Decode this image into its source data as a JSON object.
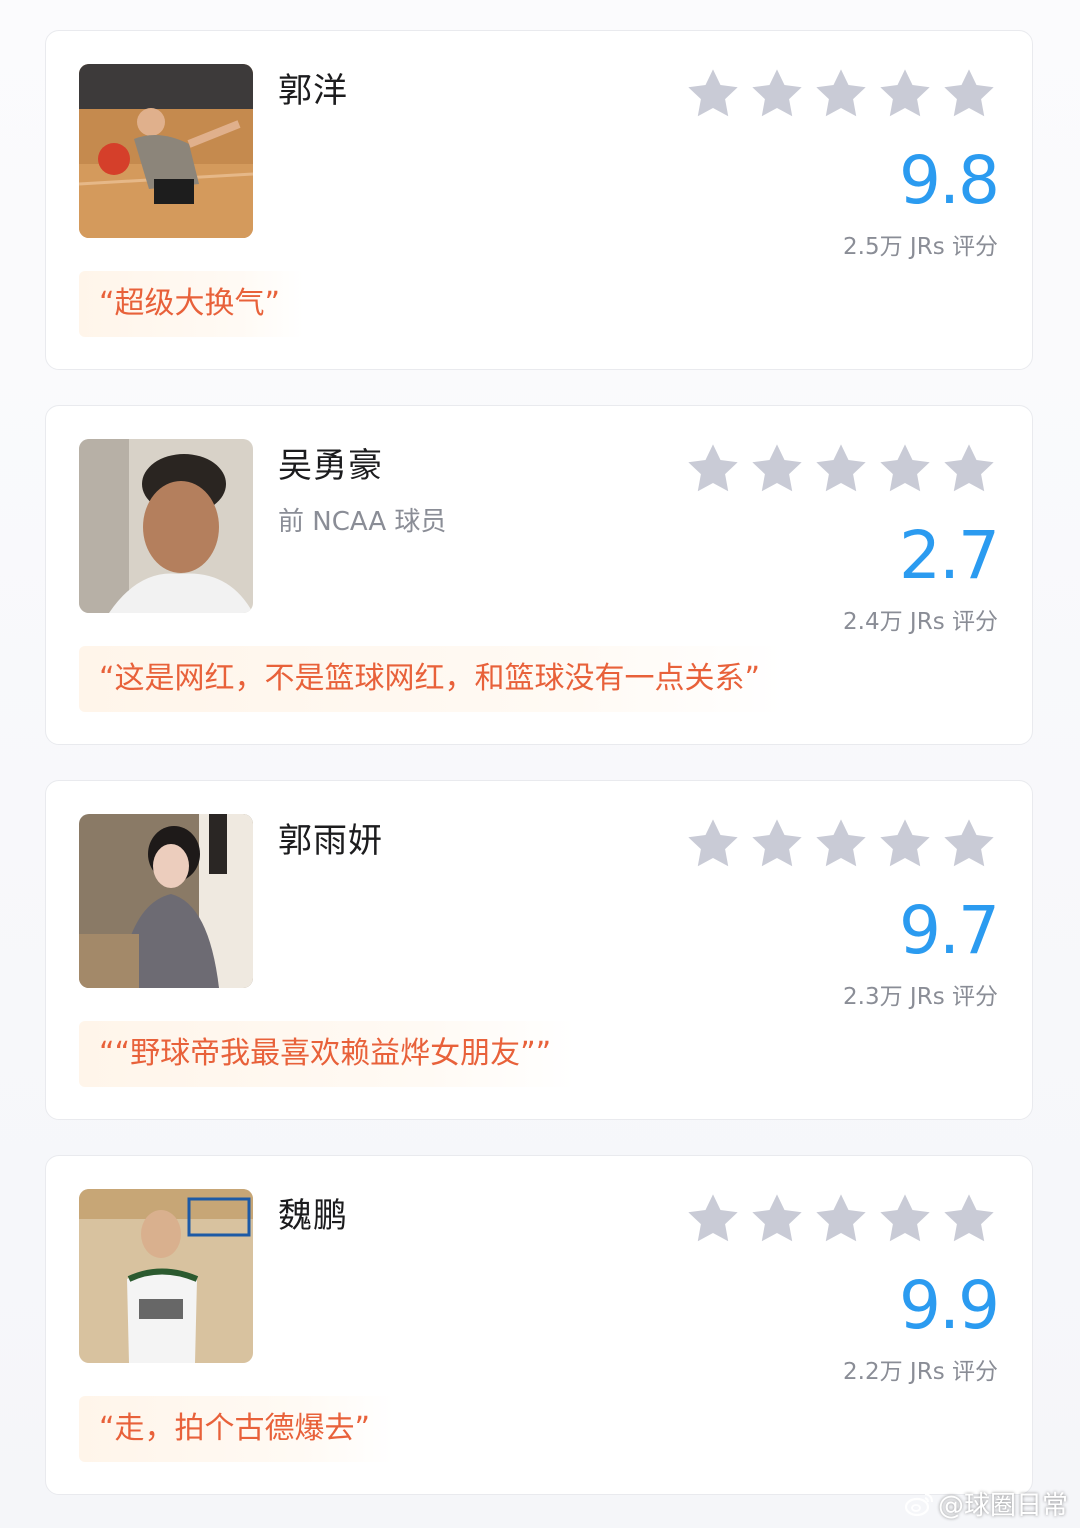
{
  "colors": {
    "score": "#2b9bf0",
    "quote_text": "#e8613a",
    "quote_bg": "#fff5ea",
    "star": "#c9cbd6",
    "name": "#1c1c1e",
    "muted": "#8a8d96"
  },
  "players": [
    {
      "name": "郭洋",
      "subtitle": "",
      "score": "9.8",
      "rating_count": "2.5万 JRs 评分",
      "quote": "“超级大换气”",
      "stars_filled": 0,
      "stars_total": 5
    },
    {
      "name": "吴勇豪",
      "subtitle": "前 NCAA 球员",
      "score": "2.7",
      "rating_count": "2.4万 JRs 评分",
      "quote": "“这是网红，不是篮球网红，和篮球没有一点关系”",
      "stars_filled": 0,
      "stars_total": 5
    },
    {
      "name": "郭雨妍",
      "subtitle": "",
      "score": "9.7",
      "rating_count": "2.3万 JRs 评分",
      "quote": "““野球帝我最喜欢赖益烨女朋友””",
      "stars_filled": 0,
      "stars_total": 5
    },
    {
      "name": "魏鹏",
      "subtitle": "",
      "score": "9.9",
      "rating_count": "2.2万 JRs 评分",
      "quote": "“走，拍个古德爆去”",
      "stars_filled": 0,
      "stars_total": 5
    }
  ],
  "watermark": {
    "icon": "weibo-icon",
    "text": "@球圈日常"
  }
}
